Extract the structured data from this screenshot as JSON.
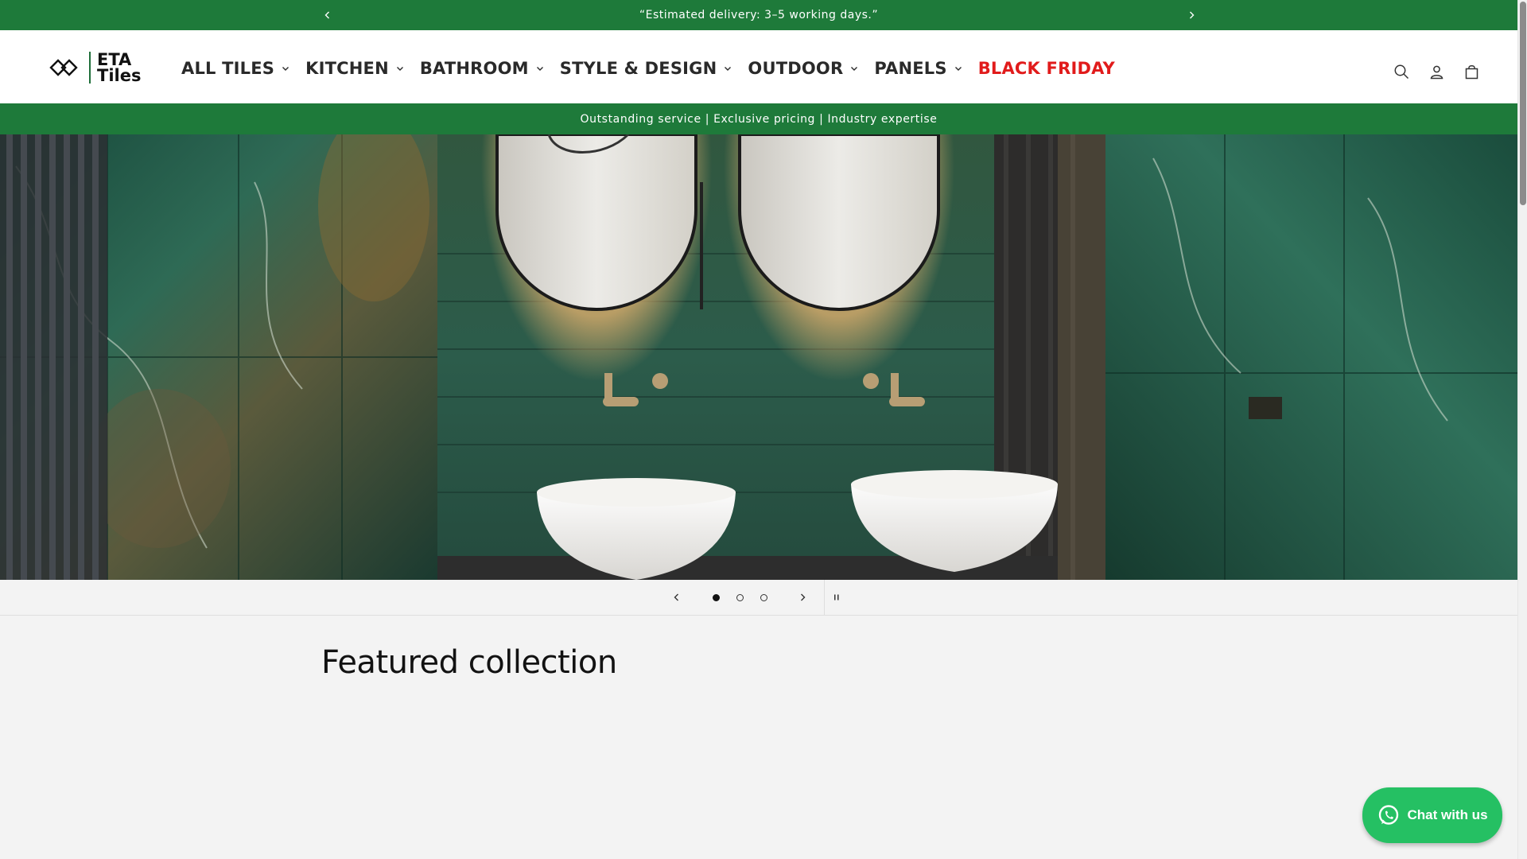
{
  "announcement": {
    "text": "“Estimated delivery: 3–5 working days.”",
    "prev_icon": "chevron-left-icon",
    "next_icon": "chevron-right-icon"
  },
  "header": {
    "logo": {
      "line1": "ETA",
      "line2": "Tiles",
      "icon": "diamond-link-logo"
    },
    "nav": [
      {
        "label": "ALL TILES",
        "has_dropdown": true
      },
      {
        "label": "KITCHEN",
        "has_dropdown": true
      },
      {
        "label": "BATHROOM",
        "has_dropdown": true
      },
      {
        "label": "STYLE & DESIGN",
        "has_dropdown": true
      },
      {
        "label": "OUTDOOR",
        "has_dropdown": true
      },
      {
        "label": "PANELS",
        "has_dropdown": true
      },
      {
        "label": "BLACK FRIDAY",
        "has_dropdown": false,
        "color": "#e11b1b"
      }
    ],
    "icons": [
      "search-icon",
      "account-icon",
      "cart-icon"
    ]
  },
  "value_bar": {
    "text": "Outstanding service | Exclusive pricing | Industry expertise"
  },
  "hero": {
    "image": "bathroom-vanity-green-tiles-illustration"
  },
  "slider": {
    "total_slides": 3,
    "current_slide": 1,
    "prev_icon": "chevron-left-icon",
    "next_icon": "chevron-right-icon",
    "pause_icon": "pause-icon"
  },
  "featured": {
    "title": "Featured collection"
  },
  "chat": {
    "label": "Chat with us",
    "icon": "whatsapp-icon"
  },
  "colors": {
    "brand_green": "#1e7a3a",
    "sale_red": "#e11b1b",
    "chat_green": "#25c063"
  }
}
